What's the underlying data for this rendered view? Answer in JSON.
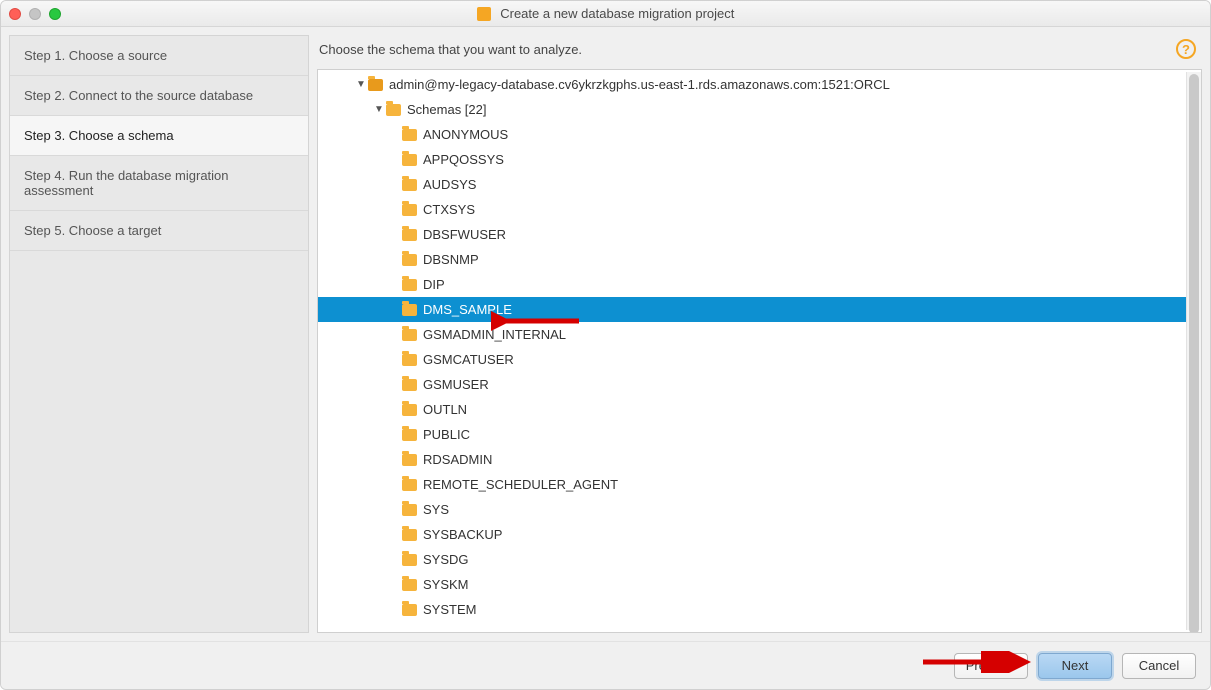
{
  "window": {
    "title": "Create a new database migration project"
  },
  "sidebar": {
    "steps": [
      {
        "label": "Step 1. Choose a source",
        "active": false
      },
      {
        "label": "Step 2. Connect to the source database",
        "active": false
      },
      {
        "label": "Step 3. Choose a schema",
        "active": true
      },
      {
        "label": "Step 4. Run the database migration assessment",
        "active": false
      },
      {
        "label": "Step 5. Choose a target",
        "active": false
      }
    ]
  },
  "main": {
    "instruction": "Choose the schema that you want to analyze.",
    "connection": "admin@my-legacy-database.cv6ykrzkgphs.us-east-1.rds.amazonaws.com:1521:ORCL",
    "schemas_label": "Schemas [22]",
    "schemas": [
      "ANONYMOUS",
      "APPQOSSYS",
      "AUDSYS",
      "CTXSYS",
      "DBSFWUSER",
      "DBSNMP",
      "DIP",
      "DMS_SAMPLE",
      "GSMADMIN_INTERNAL",
      "GSMCATUSER",
      "GSMUSER",
      "OUTLN",
      "PUBLIC",
      "RDSADMIN",
      "REMOTE_SCHEDULER_AGENT",
      "SYS",
      "SYSBACKUP",
      "SYSDG",
      "SYSKM",
      "SYSTEM"
    ],
    "selected_schema": "DMS_SAMPLE"
  },
  "footer": {
    "previous": "Previous",
    "next": "Next",
    "cancel": "Cancel"
  },
  "help_glyph": "?"
}
